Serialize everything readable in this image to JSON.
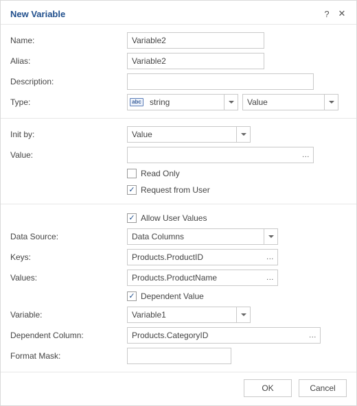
{
  "title": "New Variable",
  "labels": {
    "name": "Name:",
    "alias": "Alias:",
    "description": "Description:",
    "type": "Type:",
    "init_by": "Init by:",
    "value": "Value:",
    "data_source": "Data Source:",
    "keys": "Keys:",
    "values": "Values:",
    "variable": "Variable:",
    "dependent_column": "Dependent Column:",
    "format_mask": "Format Mask:"
  },
  "fields": {
    "name": "Variable2",
    "alias": "Variable2",
    "description": "",
    "type_badge": "abc",
    "type": "string",
    "type_value": "Value",
    "init_by": "Value",
    "value": "",
    "data_source": "Data Columns",
    "keys": "Products.ProductID",
    "values": "Products.ProductName",
    "variable": "Variable1",
    "dependent_column": "Products.CategoryID",
    "format_mask": ""
  },
  "checkboxes": {
    "read_only": {
      "label": "Read Only",
      "checked": false
    },
    "request_from_user": {
      "label": "Request from User",
      "checked": true
    },
    "allow_user_values": {
      "label": "Allow User Values",
      "checked": true
    },
    "dependent_value": {
      "label": "Dependent Value",
      "checked": true
    }
  },
  "buttons": {
    "ok": "OK",
    "cancel": "Cancel"
  },
  "glyphs": {
    "help": "?",
    "close": "✕",
    "dots": "..."
  }
}
